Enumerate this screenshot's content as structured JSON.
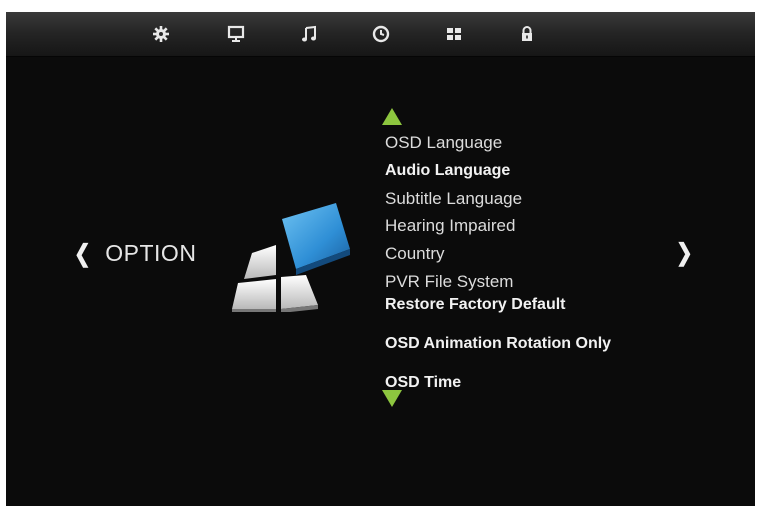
{
  "topbar": {
    "icons": [
      "settings-gear-icon",
      "monitor-icon",
      "music-note-icon",
      "clock-icon",
      "grid-icon",
      "lock-icon"
    ]
  },
  "page": {
    "title": "OPTION",
    "prev_glyph": "❮",
    "next_glyph": "❯"
  },
  "menu": {
    "items": [
      "OSD Language",
      "Audio Language",
      "Subtitle Language",
      "Hearing Impaired",
      "Country",
      "PVR File System",
      "Restore Factory Default",
      "OSD Animation Rotation Only",
      "OSD Time"
    ]
  },
  "colors": {
    "background": "#0b0b0b",
    "accent_arrow": "#8dc63f",
    "highlight_tile": "#2f8fd6"
  }
}
